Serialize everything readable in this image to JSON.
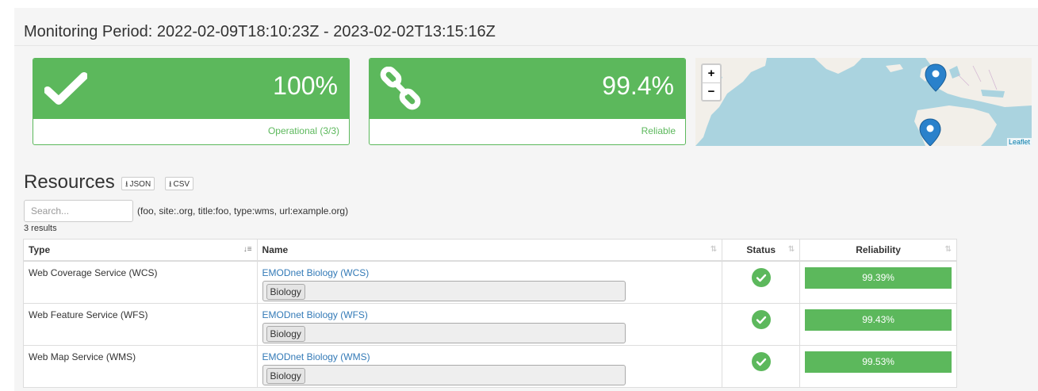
{
  "monitoring": {
    "title": "Monitoring Period: 2022-02-09T18:10:23Z - 2023-02-02T13:15:16Z"
  },
  "panels": [
    {
      "value": "100%",
      "footer": "Operational (3/3)",
      "icon": "check-icon"
    },
    {
      "value": "99.4%",
      "footer": "Reliable",
      "icon": "link-icon"
    }
  ],
  "map": {
    "zoom_in": "+",
    "zoom_out": "−",
    "attribution": "Leaflet"
  },
  "resources": {
    "title": "Resources",
    "json_label": "JSON",
    "csv_label": "CSV",
    "search_placeholder": "Search...",
    "search_hint": "(foo, site:.org, title:foo, type:wms, url:example.org)",
    "results_count": "3 results",
    "columns": [
      "Type",
      "Name",
      "Status",
      "Reliability"
    ],
    "rows": [
      {
        "type": "Web Coverage Service (WCS)",
        "name": "EMODnet Biology (WCS)",
        "tag": "Biology",
        "reliability": "99.39%"
      },
      {
        "type": "Web Feature Service (WFS)",
        "name": "EMODnet Biology (WFS)",
        "tag": "Biology",
        "reliability": "99.43%"
      },
      {
        "type": "Web Map Service (WMS)",
        "name": "EMODnet Biology (WMS)",
        "tag": "Biology",
        "reliability": "99.53%"
      }
    ]
  },
  "colors": {
    "success": "#5cb85c",
    "link": "#337ab7",
    "water": "#aad3df",
    "land": "#f2efe9",
    "marker": "#2a81cb"
  }
}
